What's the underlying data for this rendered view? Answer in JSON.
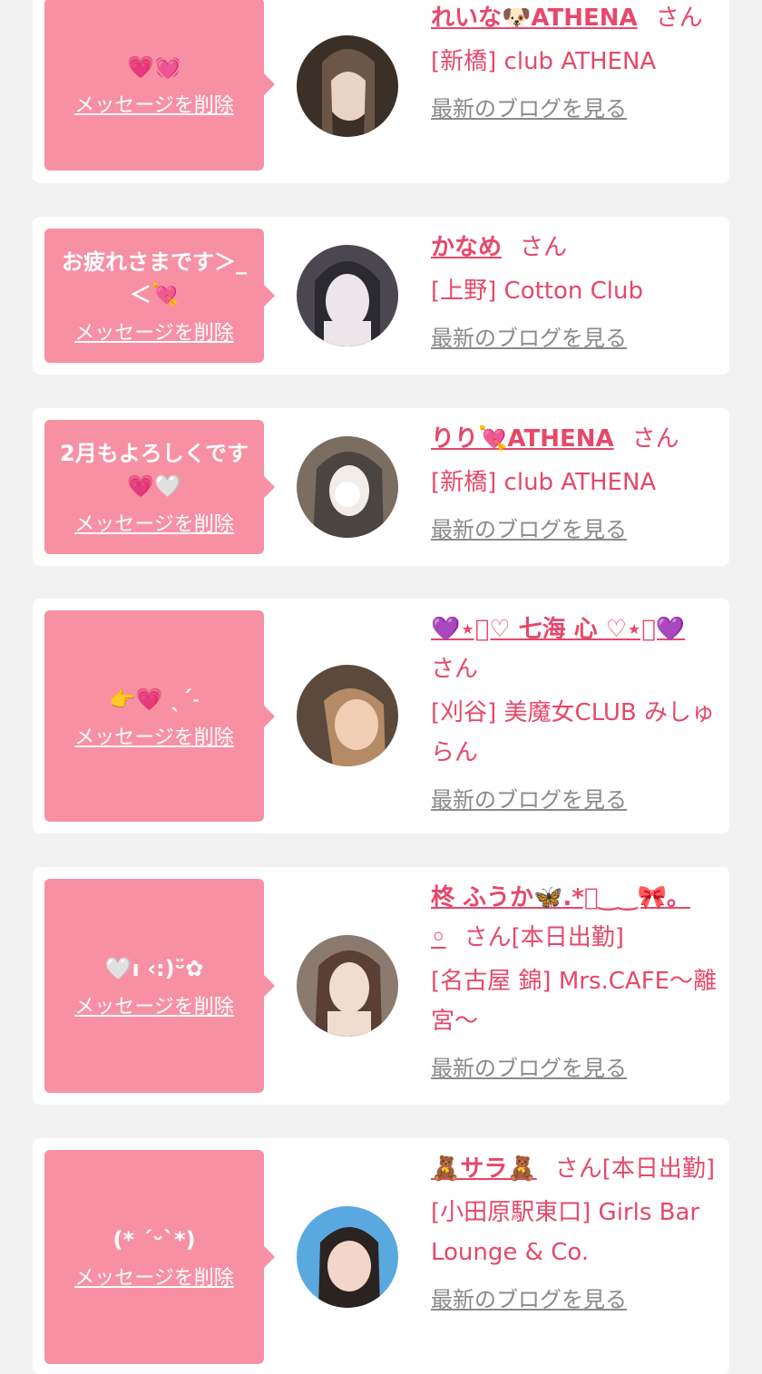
{
  "cards": [
    {
      "message": "💗💓",
      "delete_label": "メッセージを削除",
      "name": "れいな🐶ATHENA",
      "suffix": "さん",
      "shop": "[新橋] club ATHENA",
      "blog_label": "最新のブログを見る",
      "avatar_colors": [
        "#3a3028",
        "#e9d4c6",
        "#6b5648"
      ]
    },
    {
      "message": "お疲れさまです＞_＜💘",
      "delete_label": "メッセージを削除",
      "name": "かなめ",
      "suffix": "さん",
      "shop": "[上野] Cotton Club",
      "blog_label": "最新のブログを見る",
      "avatar_colors": [
        "#2a2a30",
        "#ece6ea",
        "#4b4650"
      ]
    },
    {
      "message": "2月もよろしくです💗🤍",
      "delete_label": "メッセージを削除",
      "name": "りり💘ATHENA",
      "suffix": "さん",
      "shop": "[新橋] club ATHENA",
      "blog_label": "最新のブログを見る",
      "avatar_colors": [
        "#4a4540",
        "#f2ece8",
        "#7a6d62"
      ]
    },
    {
      "message": "👉💗 ˎˊ˗",
      "delete_label": "メッセージを削除",
      "name": "💜⋆͛♡ 七海 心 ♡⋆͛💜",
      "suffix": "さん",
      "shop": "[刈谷] 美魔女CLUB みしゅらん",
      "blog_label": "最新のブログを見る",
      "avatar_colors": [
        "#5b4a3c",
        "#f0cdb3",
        "#b58a66"
      ]
    },
    {
      "message": "🤍ı ‹:)ᵕ̈✿",
      "delete_label": "メッセージを削除",
      "name": "柊 ふうか🦋.*ﾟ‿‿🎀。◦",
      "suffix": "さん[本日出勤]",
      "shop": "[名古屋 錦] Mrs.CAFE〜離宮〜",
      "blog_label": "最新のブログを見る",
      "avatar_colors": [
        "#8a7a70",
        "#f1dcd0",
        "#5c3f33"
      ]
    },
    {
      "message": "(* ˊᵕˋ*)",
      "delete_label": "メッセージを削除",
      "name": "🧸サラ🧸",
      "suffix": "さん[本日出勤]",
      "shop": "[小田原駅東口] Girls Bar Lounge & Co.",
      "blog_label": "最新のブログを見る",
      "avatar_colors": [
        "#5aa8e0",
        "#f3d6c8",
        "#2a2320"
      ]
    }
  ]
}
